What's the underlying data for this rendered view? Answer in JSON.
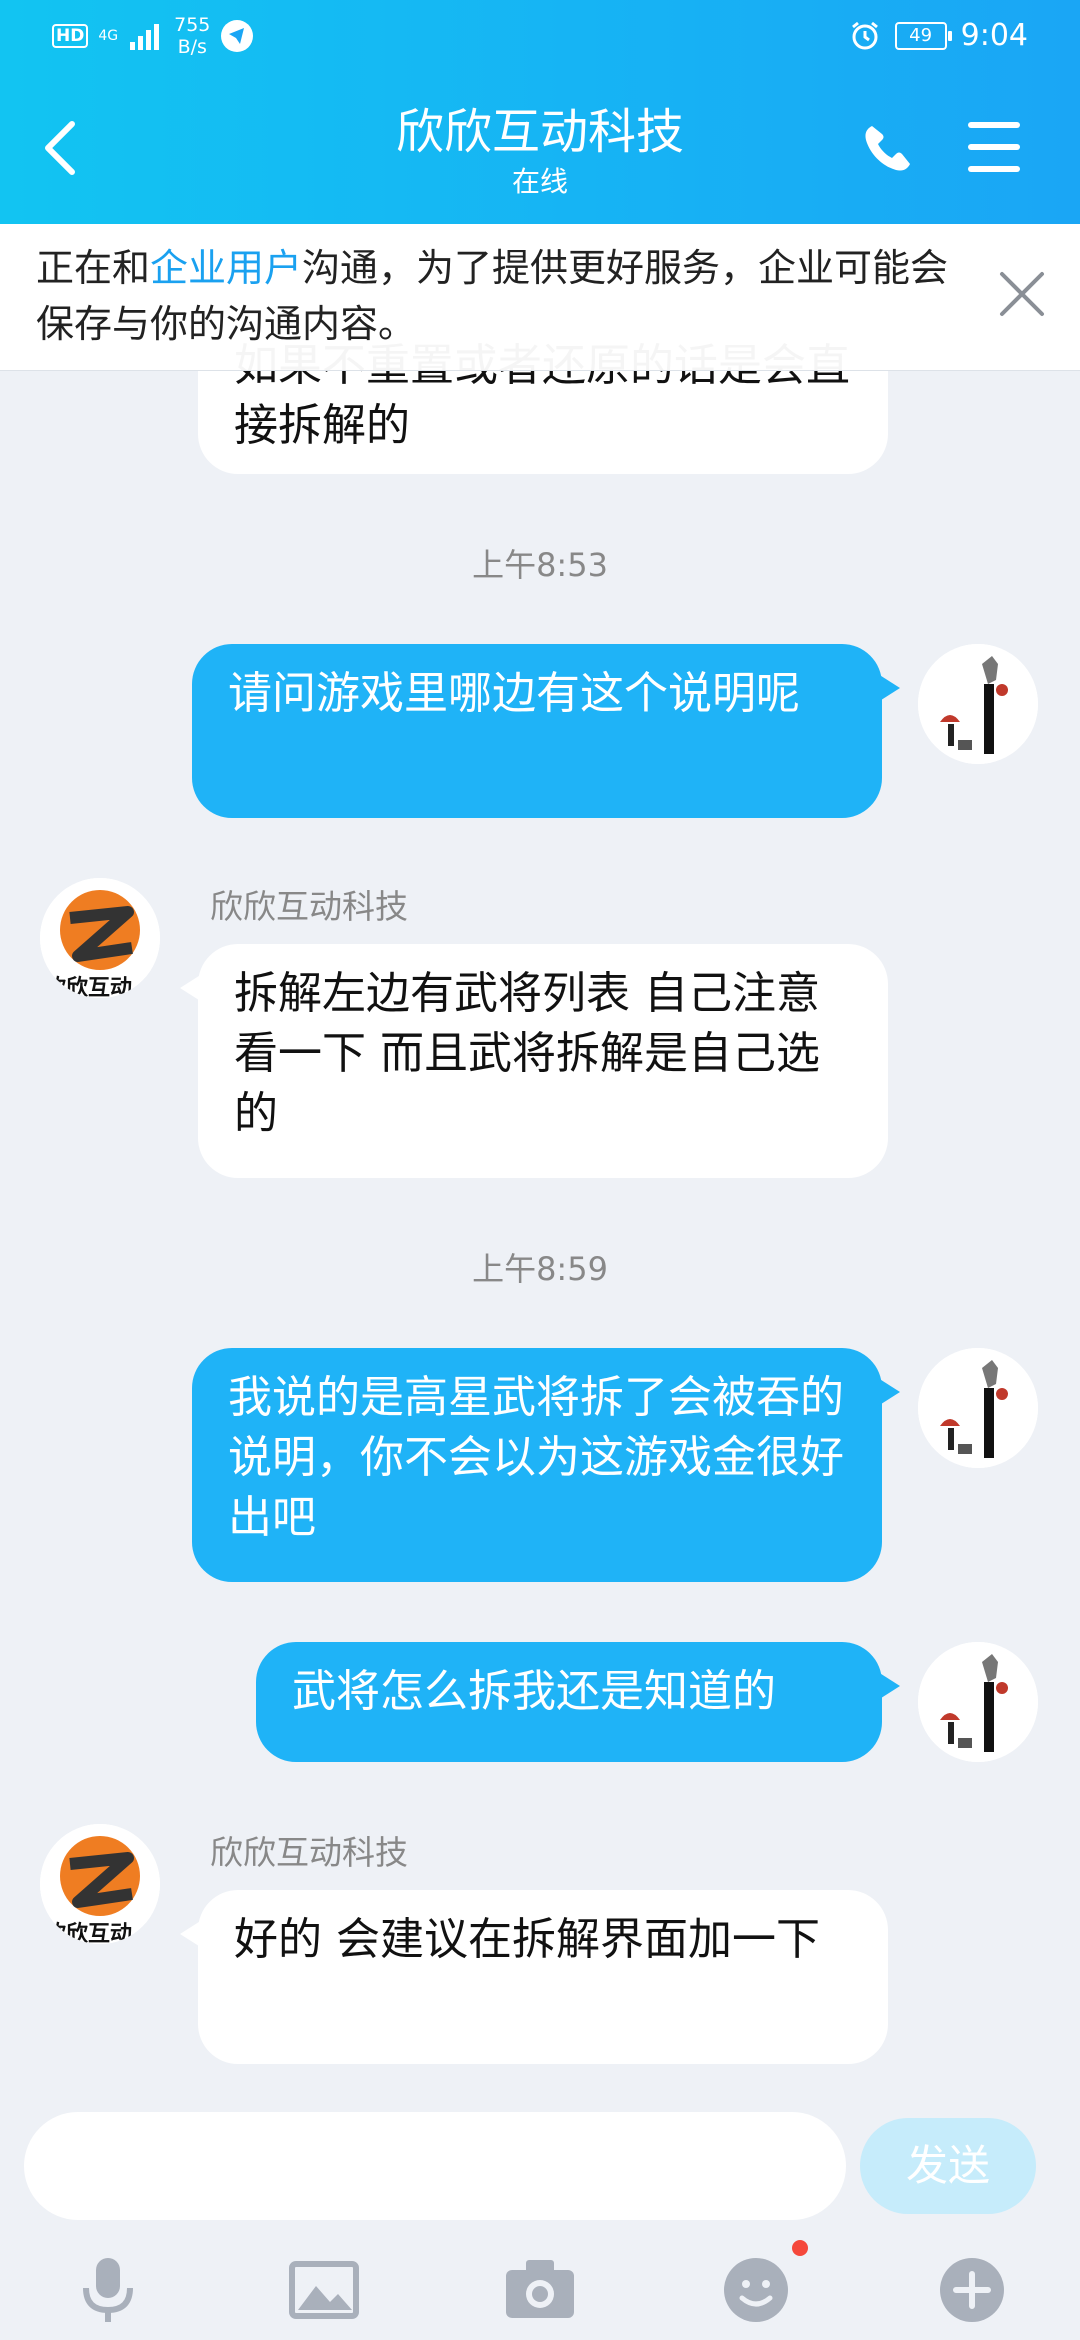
{
  "status_bar": {
    "hd": "HD",
    "network": "4G",
    "speed_value": "755",
    "speed_unit": "B/s",
    "battery": "49",
    "time": "9:04"
  },
  "header": {
    "title": "欣欣互动科技",
    "subtitle": "在线"
  },
  "notice": {
    "prefix": "正在和",
    "highlight": "企业用户",
    "suffix": "沟通，为了提供更好服务，企业可能会保存与你的沟通内容。"
  },
  "messages": [
    {
      "type": "in",
      "text": "如果不重置或者还原的话是会直接拆解的"
    },
    {
      "type": "time",
      "text": "上午8:53"
    },
    {
      "type": "out",
      "text": "请问游戏里哪边有这个说明呢"
    },
    {
      "type": "in",
      "sender": "欣欣互动科技",
      "text": "拆解左边有武将列表 自己注意看一下 而且武将拆解是自己选的"
    },
    {
      "type": "time",
      "text": "上午8:59"
    },
    {
      "type": "out",
      "text": "我说的是高星武将拆了会被吞的说明，你不会以为这游戏金很好出吧"
    },
    {
      "type": "out",
      "text": "武将怎么拆我还是知道的"
    },
    {
      "type": "in",
      "sender": "欣欣互动科技",
      "text": "好的 会建议在拆解界面加一下"
    }
  ],
  "input": {
    "value": "",
    "placeholder": "",
    "send_label": "发送"
  },
  "avatar_logo_text": "欣欣互动",
  "icons": [
    "back-arrow-icon",
    "phone-icon",
    "menu-icon",
    "close-icon",
    "microphone-icon",
    "image-icon",
    "camera-icon",
    "emoji-icon",
    "plus-icon"
  ],
  "colors": {
    "header_start": "#12c4f2",
    "header_end": "#1aa6f5",
    "outgoing_bubble": "#1fb3f7",
    "incoming_bubble": "#ffffff",
    "send_button": "#c6ecfb",
    "highlight": "#1aa1f0"
  }
}
